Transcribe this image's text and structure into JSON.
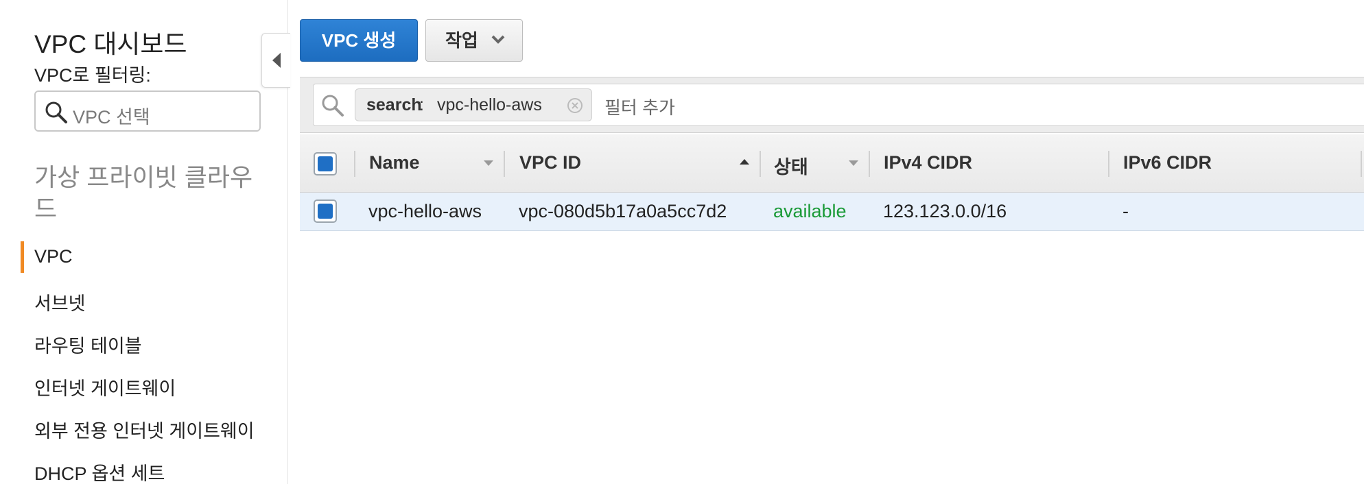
{
  "sidebar": {
    "title": "VPC 대시보드",
    "filter_label": "VPC로 필터링:",
    "vpc_select_placeholder": "VPC 선택",
    "section_title": "가상 프라이빗 클라우드",
    "items": [
      {
        "label": "VPC",
        "active": true
      },
      {
        "label": "서브넷"
      },
      {
        "label": "라우팅 테이블"
      },
      {
        "label": "인터넷 게이트웨이"
      },
      {
        "label": "외부 전용 인터넷 게이트웨이"
      },
      {
        "label": "DHCP 옵션 세트"
      }
    ],
    "accent_color": "#f08a24"
  },
  "toolbar": {
    "create_label": "VPC 생성",
    "action_label": "작업"
  },
  "filter": {
    "token_key": "search",
    "token_sep": " : ",
    "token_value": "vpc-hello-aws",
    "add_filter_label": "필터 추가"
  },
  "table": {
    "columns": [
      "Name",
      "VPC ID",
      "상태",
      "IPv4 CIDR",
      "IPv6 CIDR"
    ],
    "rows": [
      {
        "name": "vpc-hello-aws",
        "vpc_id": "vpc-080d5b17a0a5cc7d2",
        "state": "available",
        "ipv4": "123.123.0.0/16",
        "ipv6": "-"
      }
    ]
  },
  "colors": {
    "primary": "#1f6fc5",
    "available": "#1a9a37"
  }
}
